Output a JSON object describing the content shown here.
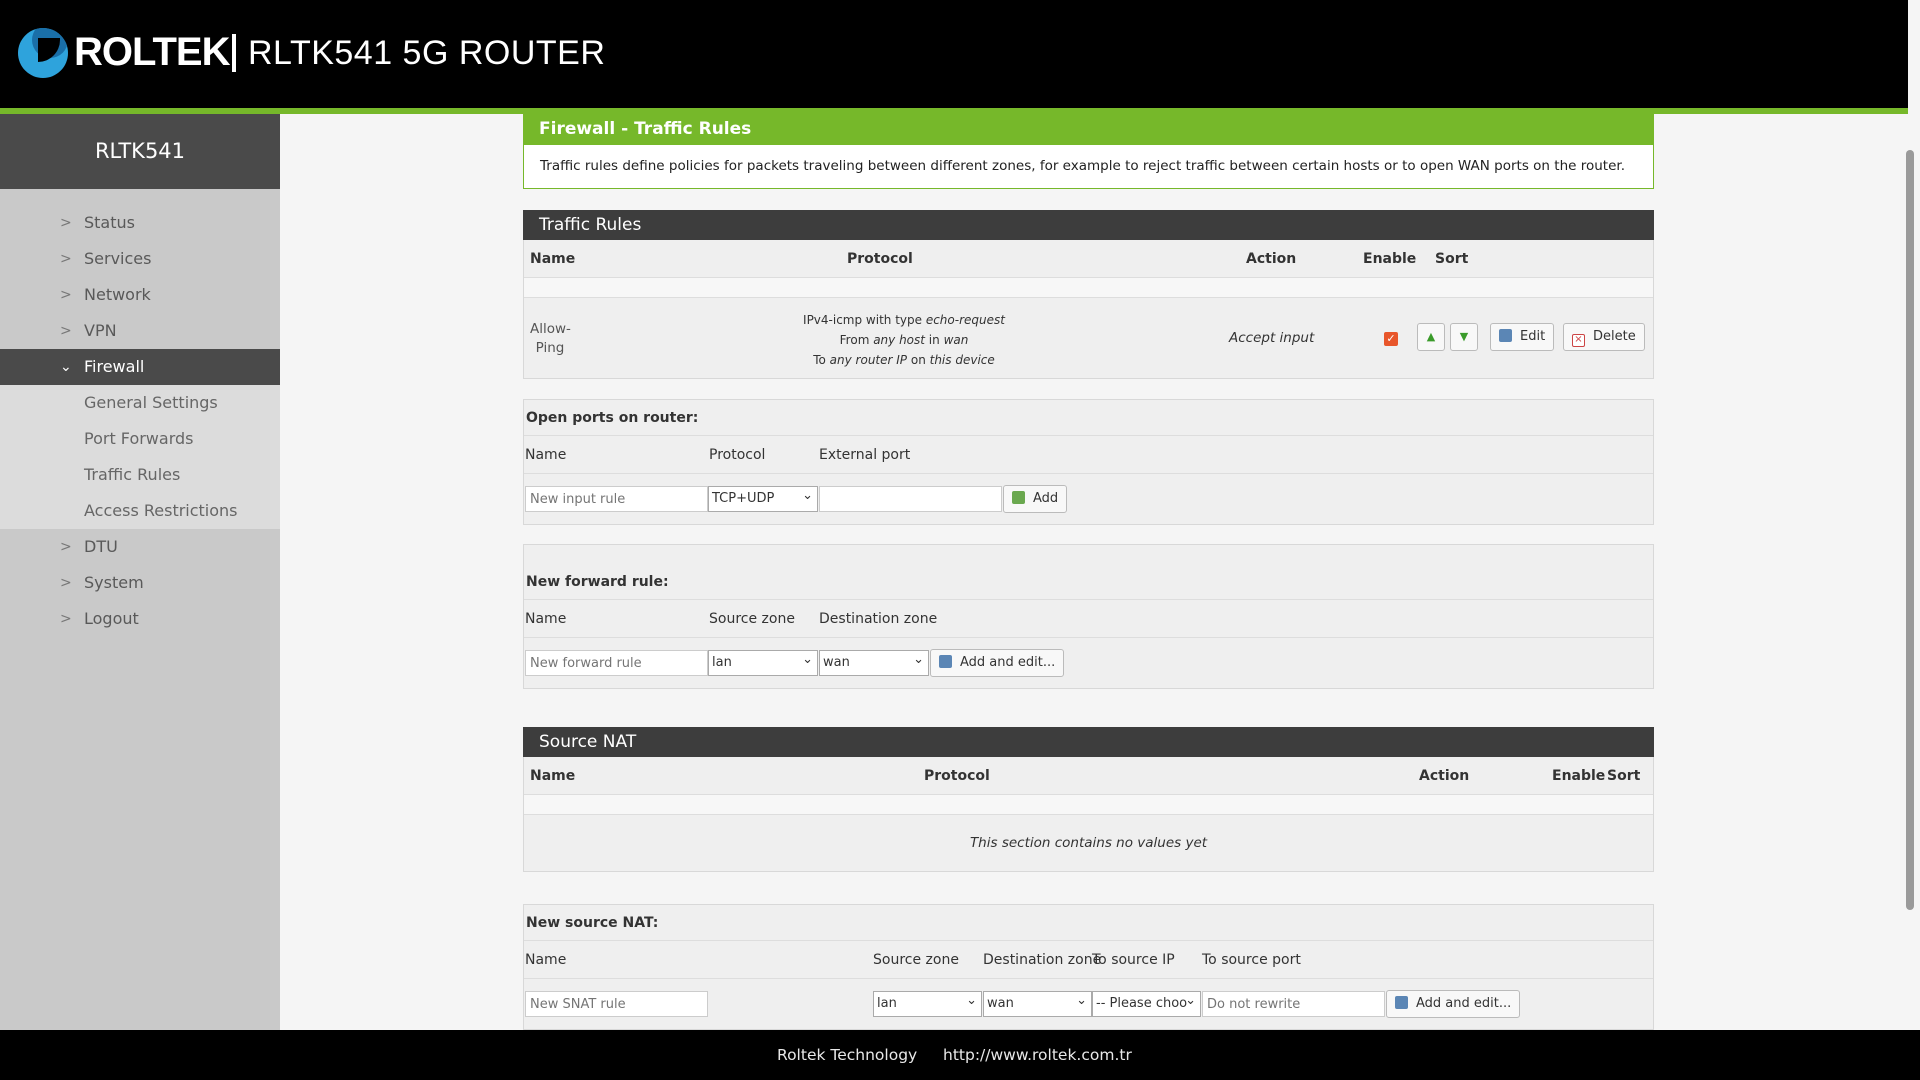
{
  "header": {
    "brand": "ROLTEK",
    "product": "RLTK541  5G  ROUTER",
    "brand_color": "#000000",
    "accent_color": "#76b82a"
  },
  "sidebar": {
    "title": "RLTK541",
    "items": [
      {
        "label": "Status",
        "icon": "chevron-right-icon"
      },
      {
        "label": "Services",
        "icon": "chevron-right-icon"
      },
      {
        "label": "Network",
        "icon": "chevron-right-icon"
      },
      {
        "label": "VPN",
        "icon": "chevron-right-icon"
      },
      {
        "label": "Firewall",
        "icon": "chevron-down-icon",
        "active": true
      },
      {
        "label": "DTU",
        "icon": "chevron-right-icon"
      },
      {
        "label": "System",
        "icon": "chevron-right-icon"
      },
      {
        "label": "Logout",
        "icon": "chevron-right-icon"
      }
    ],
    "firewall_sub": [
      "General Settings",
      "Port Forwards",
      "Traffic Rules",
      "Access Restrictions"
    ]
  },
  "page": {
    "title": "Firewall - Traffic Rules",
    "description": "Traffic rules define policies for packets traveling between different zones, for example to reject traffic between certain hosts or to open WAN ports on the router."
  },
  "traffic_rules": {
    "heading": "Traffic Rules",
    "columns": [
      "Name",
      "Protocol",
      "Action",
      "Enable",
      "Sort"
    ],
    "row": {
      "name_line1": "Allow-",
      "name_line2": "Ping",
      "proto1_a": "IPv4-icmp with type ",
      "proto1_b": "echo-request",
      "proto2_a": "From ",
      "proto2_b": "any host",
      "proto2_c": " in ",
      "proto2_d": "wan",
      "proto3_a": "To ",
      "proto3_b": "any router IP",
      "proto3_c": " on ",
      "proto3_d": "this device",
      "action": "Accept input",
      "enabled": true,
      "edit_label": "Edit",
      "delete_label": "Delete"
    }
  },
  "open_ports": {
    "title": "Open ports on router:",
    "columns": [
      "Name",
      "Protocol",
      "External port"
    ],
    "name_placeholder": "New input rule",
    "protocol_value": "TCP+UDP",
    "port_value": "",
    "add_label": "Add"
  },
  "forward_rule": {
    "title": "New forward rule:",
    "columns": [
      "Name",
      "Source zone",
      "Destination zone"
    ],
    "name_placeholder": "New forward rule",
    "source_value": "lan",
    "dest_value": "wan",
    "add_label": "Add and edit..."
  },
  "source_nat": {
    "heading": "Source NAT",
    "columns": [
      "Name",
      "Protocol",
      "Action",
      "Enable",
      "Sort"
    ],
    "empty_text": "This section contains no values yet"
  },
  "new_snat": {
    "title": "New source NAT:",
    "columns": [
      "Name",
      "Source zone",
      "Destination zone",
      "To source IP",
      "To source port"
    ],
    "name_placeholder": "New SNAT rule",
    "source_value": "lan",
    "dest_value": "wan",
    "ip_value": "-- Please choo",
    "port_placeholder": "Do not rewrite",
    "add_label": "Add and edit..."
  },
  "footer": {
    "company": "Roltek Technology",
    "url": "http://www.roltek.com.tr"
  }
}
